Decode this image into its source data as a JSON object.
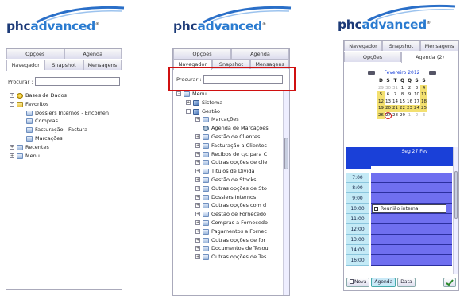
{
  "brand": {
    "logo_dark": "phc",
    "logo_blue": "advanced",
    "registered": "®"
  },
  "panel1": {
    "top_tabs": [
      "Opções",
      "Agenda"
    ],
    "tabs": [
      "Navegador",
      "Snapshot",
      "Mensagens"
    ],
    "search_label": "Procurar :",
    "tree": [
      {
        "label": "Bases de Dados",
        "icon": "db",
        "expander": "+",
        "level": 0
      },
      {
        "label": "Favoritos",
        "icon": "star",
        "expander": "-",
        "level": 0
      },
      {
        "label": "Dossiers Internos - Encomen",
        "icon": "folder",
        "expander": "",
        "level": 1
      },
      {
        "label": "Compras",
        "icon": "folder",
        "expander": "",
        "level": 1
      },
      {
        "label": "Facturação - Factura",
        "icon": "folder",
        "expander": "",
        "level": 1
      },
      {
        "label": "Marcações",
        "icon": "folder",
        "expander": "",
        "level": 1
      },
      {
        "label": "Recentes",
        "icon": "folder",
        "expander": "+",
        "level": 0
      },
      {
        "label": "Menu",
        "icon": "folder",
        "expander": "+",
        "level": 0
      }
    ]
  },
  "panel2": {
    "top_tabs": [
      "Opções",
      "Agenda"
    ],
    "tabs": [
      "Navegador",
      "Snapshot",
      "Mensagens"
    ],
    "search_label": "Procurar :",
    "tree": [
      {
        "label": "Menu",
        "icon": "folder",
        "expander": "-",
        "level": 0
      },
      {
        "label": "Sistema",
        "icon": "cube",
        "expander": "+",
        "level": 1
      },
      {
        "label": "Gestão",
        "icon": "cube",
        "expander": "-",
        "level": 1
      },
      {
        "label": "Marcações",
        "icon": "folder",
        "expander": "+",
        "level": 2
      },
      {
        "label": "Agenda de Marcações",
        "icon": "gear",
        "expander": "",
        "level": 2
      },
      {
        "label": "Gestão de Clientes",
        "icon": "folder",
        "expander": "+",
        "level": 2
      },
      {
        "label": "Facturação a Clientes",
        "icon": "folder",
        "expander": "+",
        "level": 2
      },
      {
        "label": "Recibos de c/c para C",
        "icon": "folder",
        "expander": "+",
        "level": 2
      },
      {
        "label": "Outras opções de clie",
        "icon": "folder",
        "expander": "+",
        "level": 2
      },
      {
        "label": "Títulos de Dívida",
        "icon": "folder",
        "expander": "+",
        "level": 2
      },
      {
        "label": "Gestão de Stocks",
        "icon": "folder",
        "expander": "+",
        "level": 2
      },
      {
        "label": "Outras opções de Sto",
        "icon": "folder",
        "expander": "+",
        "level": 2
      },
      {
        "label": "Dossiers Internos",
        "icon": "folder",
        "expander": "+",
        "level": 2
      },
      {
        "label": "Outras opções com d",
        "icon": "folder",
        "expander": "+",
        "level": 2
      },
      {
        "label": "Gestão de Fornecedo",
        "icon": "folder",
        "expander": "+",
        "level": 2
      },
      {
        "label": "Compras a Fornecedo",
        "icon": "folder",
        "expander": "+",
        "level": 2
      },
      {
        "label": "Pagamentos a Fornec",
        "icon": "folder",
        "expander": "+",
        "level": 2
      },
      {
        "label": "Outras opções de for",
        "icon": "folder",
        "expander": "+",
        "level": 2
      },
      {
        "label": "Documentos de Tesou",
        "icon": "folder",
        "expander": "+",
        "level": 2
      },
      {
        "label": "Outras opções de Tes",
        "icon": "folder",
        "expander": "+",
        "level": 2
      }
    ]
  },
  "panel3": {
    "tabs_row1": [
      "Navegador",
      "Snapshot",
      "Mensagens"
    ],
    "tabs_row2": [
      "Opções",
      "Agenda (2)"
    ],
    "calendar": {
      "month_label": "Fevereiro 2012",
      "weekdays": [
        "D",
        "S",
        "T",
        "Q",
        "Q",
        "S",
        "S"
      ],
      "weeks": [
        [
          "29",
          "30",
          "31",
          "1",
          "2",
          "3",
          "4"
        ],
        [
          "5",
          "6",
          "7",
          "8",
          "9",
          "10",
          "11"
        ],
        [
          "12",
          "13",
          "14",
          "15",
          "16",
          "17",
          "18"
        ],
        [
          "19",
          "20",
          "21",
          "22",
          "23",
          "24",
          "25"
        ],
        [
          "26",
          "27",
          "28",
          "29",
          "1",
          "2",
          "3"
        ]
      ],
      "selected_day": "27"
    },
    "schedule": {
      "header": "Seg 27 Fev",
      "times": [
        "7:00",
        "8:00",
        "9:00",
        "10:00",
        "11:00",
        "12:00",
        "13:00",
        "14:00",
        "16:00"
      ],
      "appointment": "Reunião interna",
      "appointment_time": "10:00"
    },
    "buttons": [
      "Nova",
      "Agenda",
      "Data"
    ]
  },
  "colors": {
    "accent_blue": "#1a40d8",
    "slot_purple": "#6f6ff0",
    "time_cyan": "#c4eaf6",
    "highlight_yellow": "#f3e070",
    "callout_red": "#d01010"
  }
}
